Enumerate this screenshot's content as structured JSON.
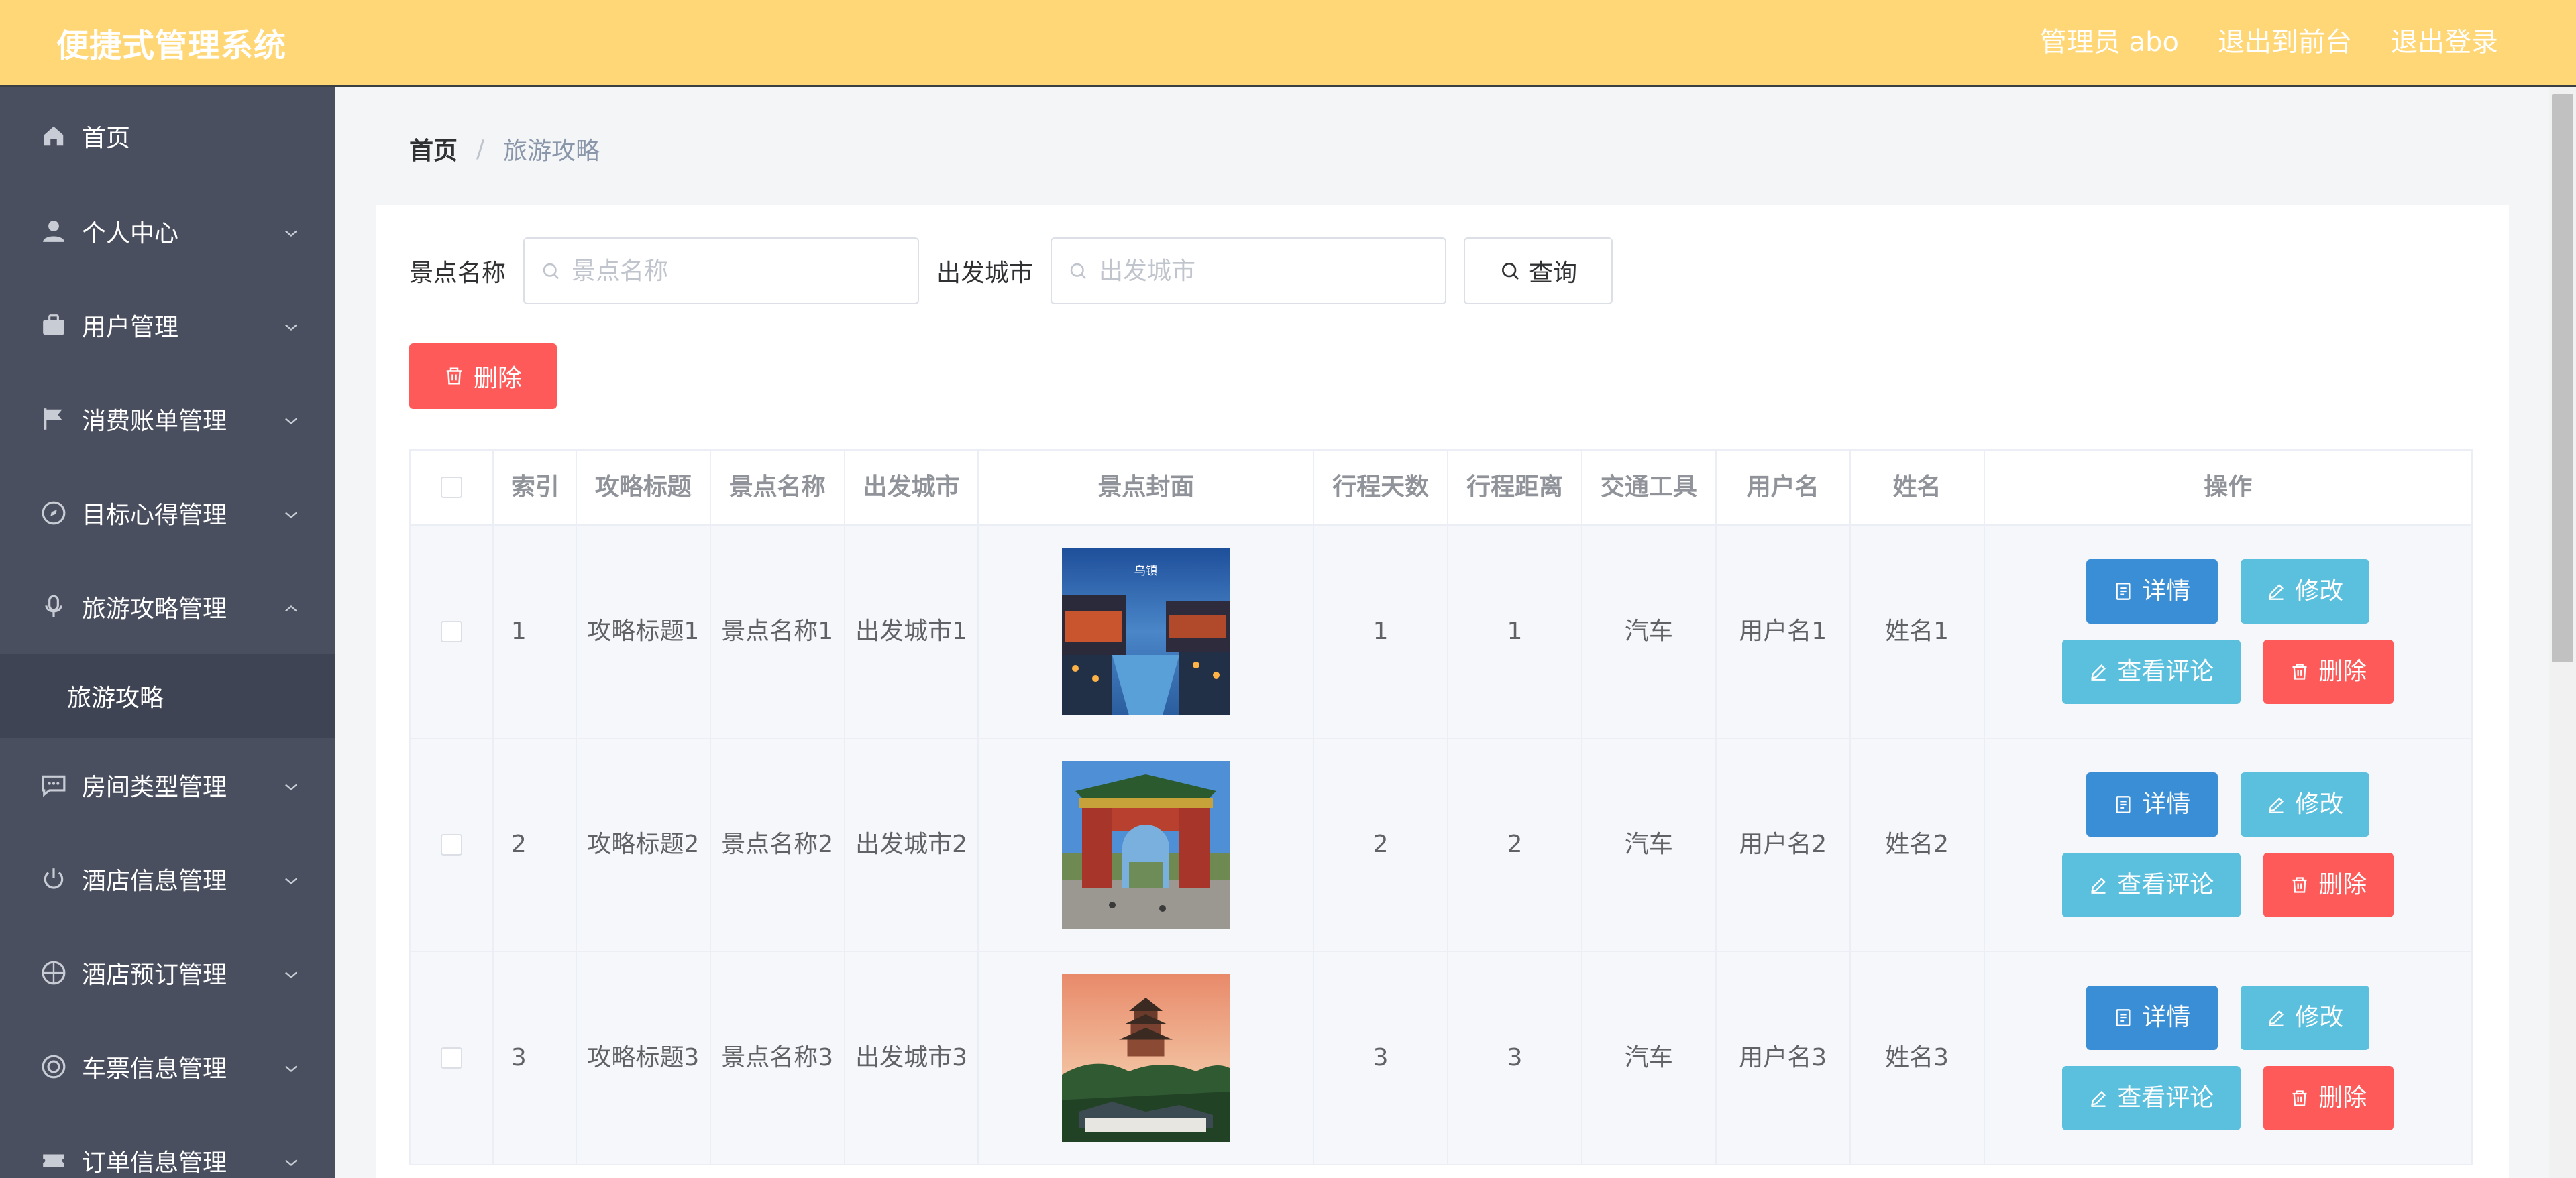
{
  "header": {
    "brand": "便捷式管理系统",
    "links": [
      "管理员 abo",
      "退出到前台",
      "退出登录"
    ]
  },
  "sidebar": {
    "items": [
      {
        "label": "首页",
        "icon": "home-icon"
      },
      {
        "label": "个人中心",
        "icon": "user-icon"
      },
      {
        "label": "用户管理",
        "icon": "briefcase-icon"
      },
      {
        "label": "消费账单管理",
        "icon": "flag-icon"
      },
      {
        "label": "目标心得管理",
        "icon": "compass-icon"
      },
      {
        "label": "旅游攻略管理",
        "icon": "microphone-icon",
        "expanded": true
      },
      {
        "label": "房间类型管理",
        "icon": "chat-icon"
      },
      {
        "label": "酒店信息管理",
        "icon": "power-icon"
      },
      {
        "label": "酒店预订管理",
        "icon": "target-icon"
      },
      {
        "label": "车票信息管理",
        "icon": "ring-icon"
      },
      {
        "label": "订单信息管理",
        "icon": "ticket-icon"
      }
    ],
    "sub_item": "旅游攻略"
  },
  "breadcrumb": {
    "home": "首页",
    "separator": "/",
    "current": "旅游攻略"
  },
  "search": {
    "name_label": "景点名称",
    "name_placeholder": "景点名称",
    "city_label": "出发城市",
    "city_placeholder": "出发城市",
    "query_label": "查询"
  },
  "toolbar": {
    "delete_label": "删除"
  },
  "table": {
    "headers": [
      "索引",
      "攻略标题",
      "景点名称",
      "出发城市",
      "景点封面",
      "行程天数",
      "行程距离",
      "交通工具",
      "用户名",
      "姓名",
      "操作"
    ],
    "rows": [
      {
        "index": "1",
        "title": "攻略标题1",
        "name": "景点名称1",
        "city": "出发城市1",
        "days": "1",
        "distance": "1",
        "transport": "汽车",
        "username": "用户名1",
        "realname": "姓名1",
        "cover": "night water town canal with lit buildings"
      },
      {
        "index": "2",
        "title": "攻略标题2",
        "name": "景点名称2",
        "city": "出发城市2",
        "days": "2",
        "distance": "2",
        "transport": "汽车",
        "username": "用户名2",
        "realname": "姓名2",
        "cover": "red traditional Chinese archway gate"
      },
      {
        "index": "3",
        "title": "攻略标题3",
        "name": "景点名称3",
        "city": "出发城市3",
        "days": "3",
        "distance": "3",
        "transport": "汽车",
        "username": "用户名3",
        "realname": "姓名3",
        "cover": "pagoda tower among trees at sunset"
      }
    ],
    "actions": {
      "detail": "详情",
      "edit": "修改",
      "comment": "查看评论",
      "delete": "删除"
    }
  },
  "colors": {
    "header_bg": "#ffd777",
    "sidebar_bg": "#4a4f5f",
    "primary": "#3a8ed6",
    "info": "#5bc0de",
    "danger": "#ff5a5a"
  }
}
